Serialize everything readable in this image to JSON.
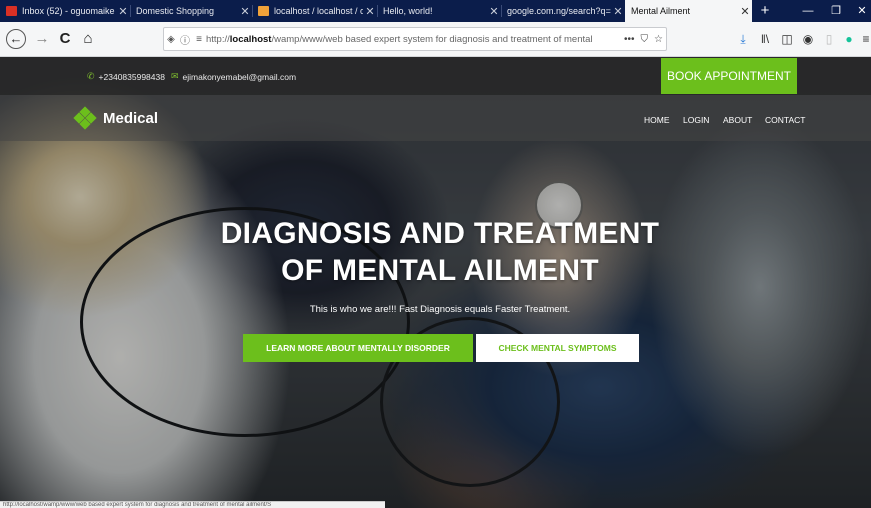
{
  "browser": {
    "tabs": [
      {
        "label": "Inbox (52) - oguomaike",
        "favicon": "gmail-icon",
        "active": false
      },
      {
        "label": "Domestic Shopping",
        "favicon": "",
        "active": false
      },
      {
        "label": "localhost / localhost / o",
        "favicon": "phpmyadmin-icon",
        "active": false
      },
      {
        "label": "Hello, world!",
        "favicon": "",
        "active": false
      },
      {
        "label": "google.com.ng/search?q=ex",
        "favicon": "",
        "active": false
      },
      {
        "label": "Mental Ailment",
        "favicon": "",
        "active": true
      }
    ],
    "new_tab": "+",
    "window_controls": {
      "minimize": "—",
      "maximize": "❐",
      "close": "✕"
    },
    "nav": {
      "back": "←",
      "forward": "→",
      "reload": "C",
      "home": "⌂"
    },
    "url": {
      "prefix": "http://",
      "host": "localhost",
      "path": "/wamp/www/web based expert system for diagnosis and treatment of mental",
      "more": "•••"
    },
    "toolbar_icons": [
      "download-icon",
      "library-icon",
      "sidebar-icon",
      "account-icon",
      "extension-icon",
      "grammarly-icon",
      "menu-icon"
    ],
    "status_url": "http://localhost/wamp/www/web based expert system for diagnosis and treatment of mental ailment/S"
  },
  "site": {
    "phone": "+2340835998438",
    "email": "ejimakonyemabel@gmail.com",
    "book_button": "BOOK APPOINTMENT",
    "brand": "Medical",
    "menu": [
      "HOME",
      "LOGIN",
      "ABOUT",
      "CONTACT"
    ],
    "hero": {
      "title_line1": "DIAGNOSIS AND TREATMENT",
      "title_line2": "OF MENTAL AILMENT",
      "subtitle": "This is who we are!!! Fast Diagnosis equals Faster Treatment.",
      "primary_button": "LEARN MORE ABOUT MENTALLY DISORDER",
      "secondary_button": "CHECK MENTAL SYMPTOMS"
    },
    "colors": {
      "accent": "#6cbf1c",
      "topbar": "#282828",
      "browser_tabbar": "#0b1d4b"
    }
  }
}
